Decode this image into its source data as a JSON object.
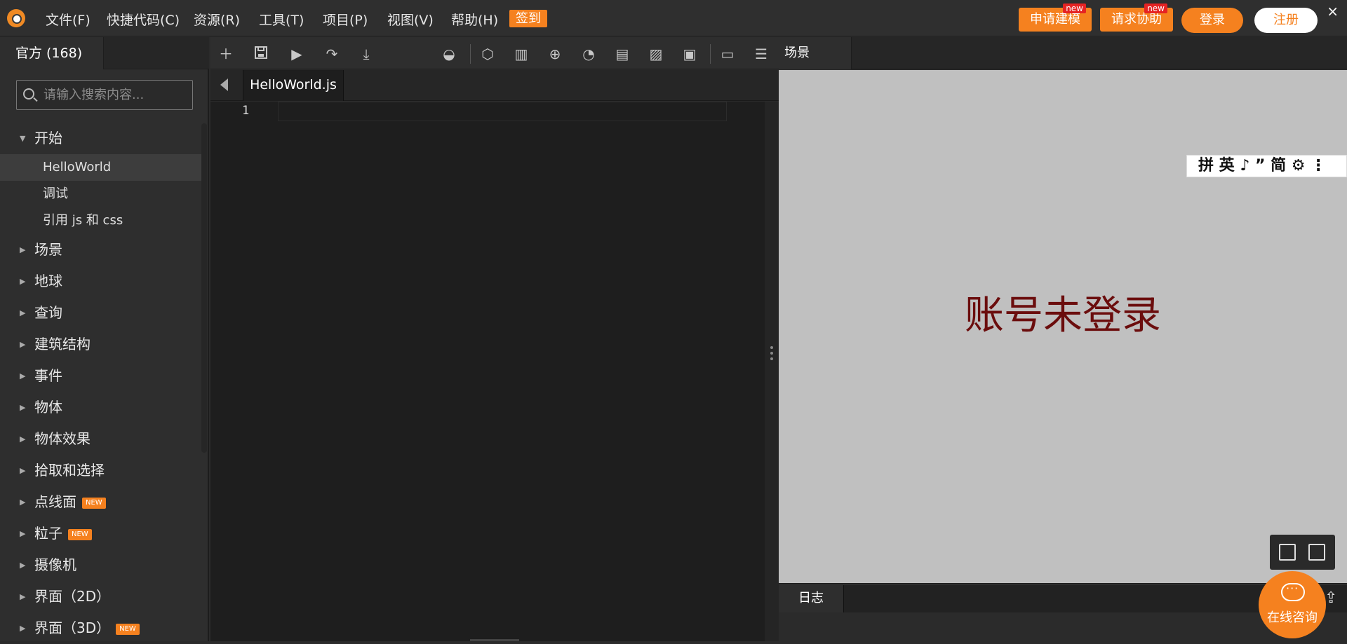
{
  "menubar": {
    "items": [
      "文件(F)",
      "快捷代码(C)",
      "资源(R)",
      "工具(T)",
      "项目(P)",
      "视图(V)",
      "帮助(H)"
    ],
    "signin": "签到",
    "apply_model": "申请建模",
    "request_help": "请求协助",
    "new_tag": "new",
    "login": "登录",
    "register": "注册",
    "close": "×"
  },
  "sidebar": {
    "tab": "官方 (168)",
    "search_placeholder": "请输入搜索内容...",
    "tree": [
      {
        "label": "开始",
        "expanded": true,
        "children": [
          "HelloWorld",
          "调试",
          "引用 js 和 css"
        ]
      },
      {
        "label": "场景"
      },
      {
        "label": "地球"
      },
      {
        "label": "查询"
      },
      {
        "label": "建筑结构"
      },
      {
        "label": "事件"
      },
      {
        "label": "物体"
      },
      {
        "label": "物体效果"
      },
      {
        "label": "拾取和选择"
      },
      {
        "label": "点线面",
        "badge": "NEW"
      },
      {
        "label": "粒子",
        "badge": "NEW"
      },
      {
        "label": "摄像机"
      },
      {
        "label": "界面（2D）"
      },
      {
        "label": "界面（3D）",
        "badge": "NEW"
      }
    ]
  },
  "editor": {
    "file_tab": "HelloWorld.js",
    "line_number": "1"
  },
  "scene": {
    "tab": "场景",
    "message": "账号未登录",
    "ime_toolbar": "拼 英 ♪ ” 简 ⚙ ⋮"
  },
  "log": {
    "tab": "日志"
  },
  "chat": {
    "label": "在线咨询"
  },
  "colors": {
    "accent": "#f5811f",
    "message": "#6b0d0d",
    "viewport": "#c0c0c0"
  }
}
